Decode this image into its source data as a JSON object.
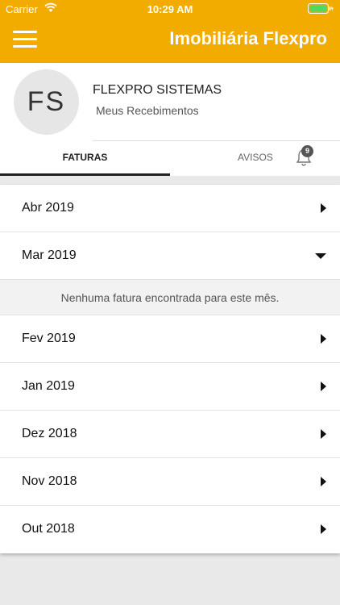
{
  "status_bar": {
    "carrier": "Carrier",
    "time": "10:29 AM"
  },
  "header": {
    "title": "Imobiliária Flexpro",
    "accent_color": "#f2ac00",
    "menu_icon": "hamburger-icon"
  },
  "profile": {
    "initials": "FS",
    "name": "FLEXPRO SISTEMAS",
    "subtitle": "Meus Recebimentos"
  },
  "tabs": [
    {
      "label": "FATURAS",
      "active": true
    },
    {
      "label": "AVISOS",
      "active": false,
      "badge": "9",
      "icon": "bell-icon"
    }
  ],
  "months": [
    {
      "label": "Abr 2019",
      "expanded": false
    },
    {
      "label": "Mar 2019",
      "expanded": true,
      "empty_message": "Nenhuma fatura encontrada para este mês."
    },
    {
      "label": "Fev 2019",
      "expanded": false
    },
    {
      "label": "Jan 2019",
      "expanded": false
    },
    {
      "label": "Dez 2018",
      "expanded": false
    },
    {
      "label": "Nov 2018",
      "expanded": false
    },
    {
      "label": "Out 2018",
      "expanded": false
    }
  ]
}
